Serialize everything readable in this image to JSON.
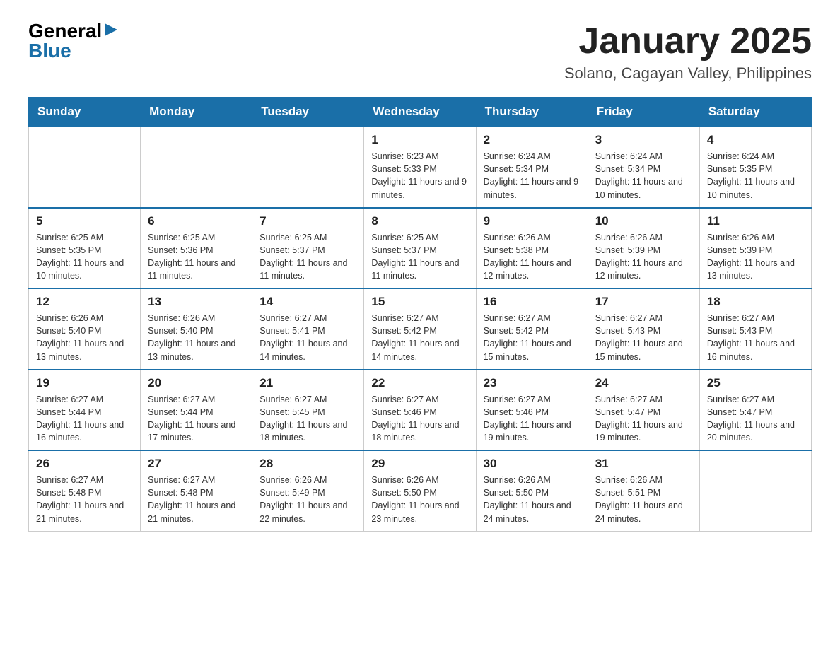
{
  "header": {
    "logo_general": "General",
    "logo_blue": "Blue",
    "month_title": "January 2025",
    "location": "Solano, Cagayan Valley, Philippines"
  },
  "weekdays": [
    "Sunday",
    "Monday",
    "Tuesday",
    "Wednesday",
    "Thursday",
    "Friday",
    "Saturday"
  ],
  "weeks": [
    [
      {
        "day": "",
        "info": ""
      },
      {
        "day": "",
        "info": ""
      },
      {
        "day": "",
        "info": ""
      },
      {
        "day": "1",
        "info": "Sunrise: 6:23 AM\nSunset: 5:33 PM\nDaylight: 11 hours and 9 minutes."
      },
      {
        "day": "2",
        "info": "Sunrise: 6:24 AM\nSunset: 5:34 PM\nDaylight: 11 hours and 9 minutes."
      },
      {
        "day": "3",
        "info": "Sunrise: 6:24 AM\nSunset: 5:34 PM\nDaylight: 11 hours and 10 minutes."
      },
      {
        "day": "4",
        "info": "Sunrise: 6:24 AM\nSunset: 5:35 PM\nDaylight: 11 hours and 10 minutes."
      }
    ],
    [
      {
        "day": "5",
        "info": "Sunrise: 6:25 AM\nSunset: 5:35 PM\nDaylight: 11 hours and 10 minutes."
      },
      {
        "day": "6",
        "info": "Sunrise: 6:25 AM\nSunset: 5:36 PM\nDaylight: 11 hours and 11 minutes."
      },
      {
        "day": "7",
        "info": "Sunrise: 6:25 AM\nSunset: 5:37 PM\nDaylight: 11 hours and 11 minutes."
      },
      {
        "day": "8",
        "info": "Sunrise: 6:25 AM\nSunset: 5:37 PM\nDaylight: 11 hours and 11 minutes."
      },
      {
        "day": "9",
        "info": "Sunrise: 6:26 AM\nSunset: 5:38 PM\nDaylight: 11 hours and 12 minutes."
      },
      {
        "day": "10",
        "info": "Sunrise: 6:26 AM\nSunset: 5:39 PM\nDaylight: 11 hours and 12 minutes."
      },
      {
        "day": "11",
        "info": "Sunrise: 6:26 AM\nSunset: 5:39 PM\nDaylight: 11 hours and 13 minutes."
      }
    ],
    [
      {
        "day": "12",
        "info": "Sunrise: 6:26 AM\nSunset: 5:40 PM\nDaylight: 11 hours and 13 minutes."
      },
      {
        "day": "13",
        "info": "Sunrise: 6:26 AM\nSunset: 5:40 PM\nDaylight: 11 hours and 13 minutes."
      },
      {
        "day": "14",
        "info": "Sunrise: 6:27 AM\nSunset: 5:41 PM\nDaylight: 11 hours and 14 minutes."
      },
      {
        "day": "15",
        "info": "Sunrise: 6:27 AM\nSunset: 5:42 PM\nDaylight: 11 hours and 14 minutes."
      },
      {
        "day": "16",
        "info": "Sunrise: 6:27 AM\nSunset: 5:42 PM\nDaylight: 11 hours and 15 minutes."
      },
      {
        "day": "17",
        "info": "Sunrise: 6:27 AM\nSunset: 5:43 PM\nDaylight: 11 hours and 15 minutes."
      },
      {
        "day": "18",
        "info": "Sunrise: 6:27 AM\nSunset: 5:43 PM\nDaylight: 11 hours and 16 minutes."
      }
    ],
    [
      {
        "day": "19",
        "info": "Sunrise: 6:27 AM\nSunset: 5:44 PM\nDaylight: 11 hours and 16 minutes."
      },
      {
        "day": "20",
        "info": "Sunrise: 6:27 AM\nSunset: 5:44 PM\nDaylight: 11 hours and 17 minutes."
      },
      {
        "day": "21",
        "info": "Sunrise: 6:27 AM\nSunset: 5:45 PM\nDaylight: 11 hours and 18 minutes."
      },
      {
        "day": "22",
        "info": "Sunrise: 6:27 AM\nSunset: 5:46 PM\nDaylight: 11 hours and 18 minutes."
      },
      {
        "day": "23",
        "info": "Sunrise: 6:27 AM\nSunset: 5:46 PM\nDaylight: 11 hours and 19 minutes."
      },
      {
        "day": "24",
        "info": "Sunrise: 6:27 AM\nSunset: 5:47 PM\nDaylight: 11 hours and 19 minutes."
      },
      {
        "day": "25",
        "info": "Sunrise: 6:27 AM\nSunset: 5:47 PM\nDaylight: 11 hours and 20 minutes."
      }
    ],
    [
      {
        "day": "26",
        "info": "Sunrise: 6:27 AM\nSunset: 5:48 PM\nDaylight: 11 hours and 21 minutes."
      },
      {
        "day": "27",
        "info": "Sunrise: 6:27 AM\nSunset: 5:48 PM\nDaylight: 11 hours and 21 minutes."
      },
      {
        "day": "28",
        "info": "Sunrise: 6:26 AM\nSunset: 5:49 PM\nDaylight: 11 hours and 22 minutes."
      },
      {
        "day": "29",
        "info": "Sunrise: 6:26 AM\nSunset: 5:50 PM\nDaylight: 11 hours and 23 minutes."
      },
      {
        "day": "30",
        "info": "Sunrise: 6:26 AM\nSunset: 5:50 PM\nDaylight: 11 hours and 24 minutes."
      },
      {
        "day": "31",
        "info": "Sunrise: 6:26 AM\nSunset: 5:51 PM\nDaylight: 11 hours and 24 minutes."
      },
      {
        "day": "",
        "info": ""
      }
    ]
  ]
}
